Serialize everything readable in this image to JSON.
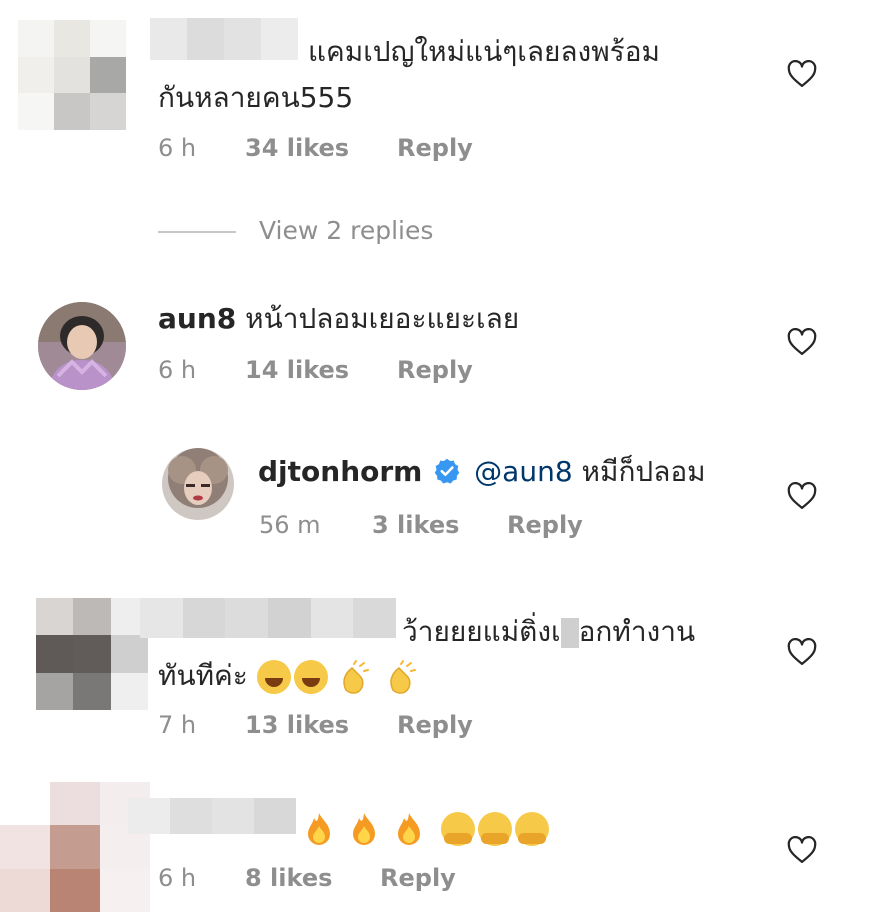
{
  "comments": [
    {
      "text_line1": "แคมเปญใหม่แน่ๆเลยลงพร้อม",
      "text_line2": "กันหลายคน555",
      "time": "6 h",
      "likes": "34 likes",
      "reply": "Reply",
      "view_replies": "View 2 replies"
    },
    {
      "username": "aun8",
      "text": "หน้าปลอมเยอะแยะเลย",
      "time": "6 h",
      "likes": "14 likes",
      "reply": "Reply"
    },
    {
      "username": "djtonhorm",
      "mention": "@aun8",
      "text": "หมีก็ปลอม",
      "time": "56 m",
      "likes": "3 likes",
      "reply": "Reply"
    },
    {
      "text_line1_a": "ว้ายยยแม่ติ่งเ",
      "text_line1_b": "อกทำงาน",
      "text_line2": "ทันทีค่ะ",
      "time": "7 h",
      "likes": "13 likes",
      "reply": "Reply"
    },
    {
      "time": "6 h",
      "likes": "8 likes",
      "reply": "Reply"
    }
  ],
  "colors": {
    "text": "#262626",
    "muted": "#8e8e8e",
    "verified": "#3897f0",
    "mention": "#00376b"
  },
  "icons": {
    "like": "heart-outline-icon",
    "verified": "verified-badge-icon"
  }
}
